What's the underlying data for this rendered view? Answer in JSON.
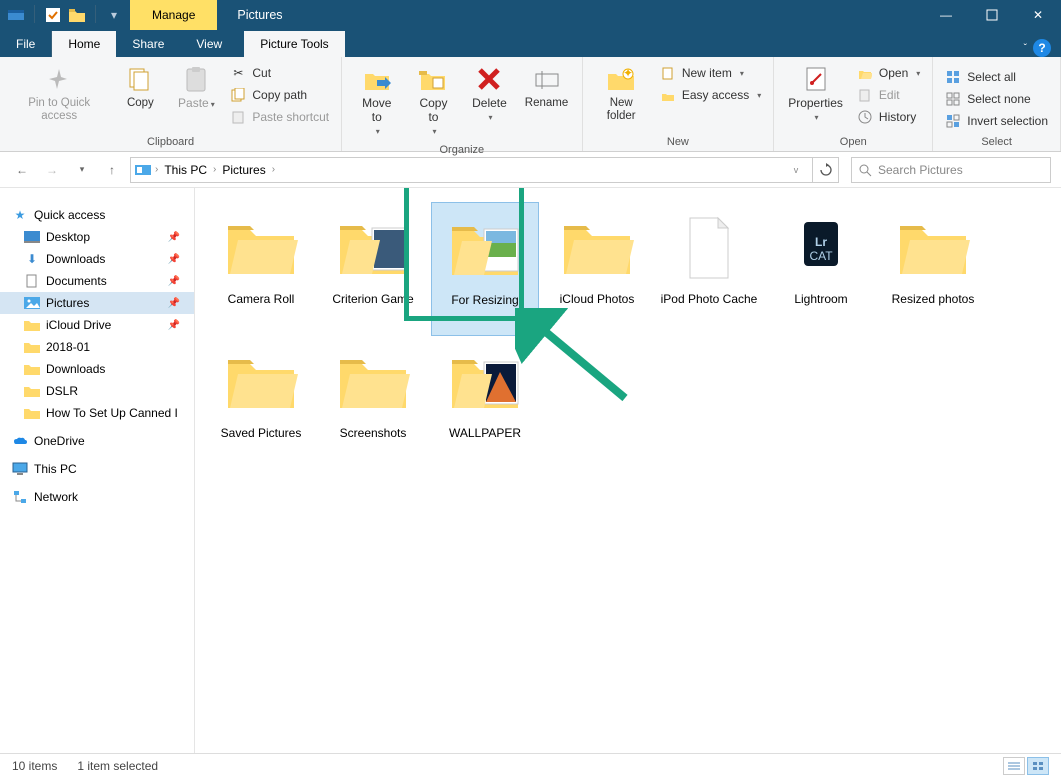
{
  "titlebar": {
    "contextual_tab": "Manage",
    "title": "Pictures"
  },
  "tabs": {
    "file": "File",
    "home": "Home",
    "share": "Share",
    "view": "View",
    "picture_tools": "Picture Tools"
  },
  "ribbon": {
    "clipboard": {
      "label": "Clipboard",
      "pin": "Pin to Quick access",
      "copy": "Copy",
      "paste": "Paste",
      "cut": "Cut",
      "copy_path": "Copy path",
      "paste_shortcut": "Paste shortcut"
    },
    "organize": {
      "label": "Organize",
      "move_to": "Move to",
      "copy_to": "Copy to",
      "delete": "Delete",
      "rename": "Rename"
    },
    "new": {
      "label": "New",
      "new_folder": "New folder",
      "new_item": "New item",
      "easy_access": "Easy access"
    },
    "open": {
      "label": "Open",
      "properties": "Properties",
      "open": "Open",
      "edit": "Edit",
      "history": "History"
    },
    "select": {
      "label": "Select",
      "select_all": "Select all",
      "select_none": "Select none",
      "invert": "Invert selection"
    }
  },
  "nav": {
    "this_pc": "This PC",
    "pictures": "Pictures"
  },
  "search": {
    "placeholder": "Search Pictures"
  },
  "sidebar": {
    "quick_access": "Quick access",
    "desktop": "Desktop",
    "downloads": "Downloads",
    "documents": "Documents",
    "pictures": "Pictures",
    "icloud": "iCloud Drive",
    "date_folder": "2018-01",
    "downloads2": "Downloads",
    "dslr": "DSLR",
    "canned": "How To Set Up Canned I",
    "onedrive": "OneDrive",
    "this_pc": "This PC",
    "network": "Network"
  },
  "folders": [
    {
      "name": "Camera Roll",
      "type": "folder"
    },
    {
      "name": "Criterion Game",
      "type": "folder-thumb"
    },
    {
      "name": "For Resizing",
      "type": "folder-thumb",
      "selected": true
    },
    {
      "name": "iCloud Photos",
      "type": "folder"
    },
    {
      "name": "iPod Photo Cache",
      "type": "file"
    },
    {
      "name": "Lightroom",
      "type": "lr"
    },
    {
      "name": "Resized photos",
      "type": "folder"
    },
    {
      "name": "Saved Pictures",
      "type": "folder"
    },
    {
      "name": "Screenshots",
      "type": "folder"
    },
    {
      "name": "WALLPAPER",
      "type": "folder-thumb2"
    }
  ],
  "status": {
    "count": "10 items",
    "selected": "1 item selected"
  }
}
